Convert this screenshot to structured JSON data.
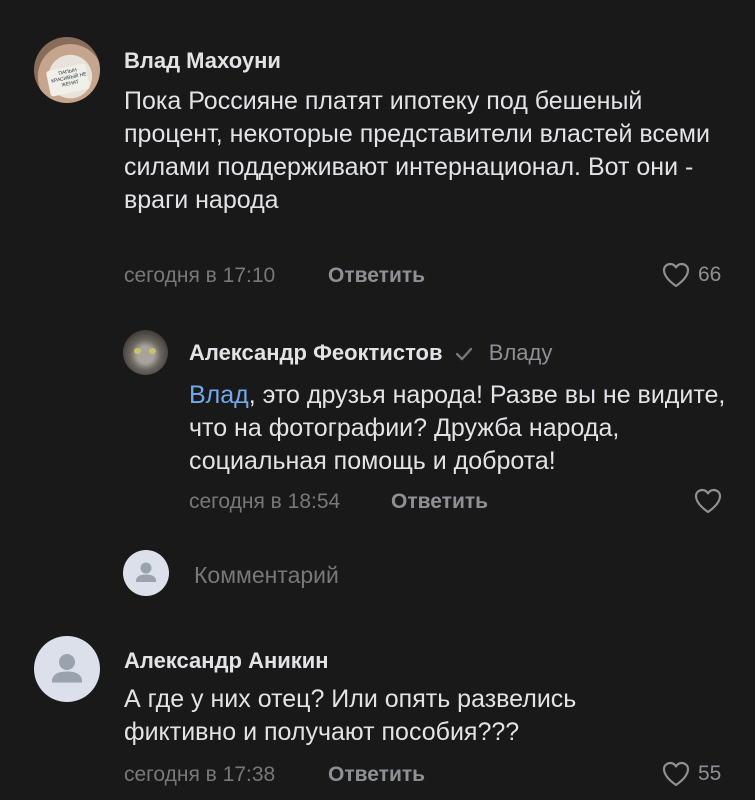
{
  "comments": [
    {
      "author": "Влад Махоуни",
      "text": "Пока Россияне платят ипотеку под бешеный процент, некоторые представители властей всеми силами поддерживают интернационал. Вот они - враги народа",
      "time": "сегодня в 17:10",
      "reply_label": "Ответить",
      "likes": "66",
      "avatar_text": "ПАПЫН КРАСИВЫЙ НЕ ЖЕНАТ"
    },
    {
      "author": "Александр Феоктистов",
      "reply_to": "Владу",
      "mention": "Влад",
      "text": ", это друзья народа! Разве вы не видите, что на фотографии? Дружба народа, социальная помощь и доброта!",
      "time": "сегодня в 18:54",
      "reply_label": "Ответить"
    },
    {
      "author": "Александр Аникин",
      "text": "А где у них отец? Или опять развелись фиктивно и получают пособия???",
      "time": "сегодня в 17:38",
      "reply_label": "Ответить",
      "likes": "55"
    }
  ],
  "composer": {
    "placeholder": "Комментарий"
  },
  "colors": {
    "background": "#19191a",
    "text": "#e1e3e6",
    "secondary": "#76787a",
    "link": "#71aaeb",
    "avatar_placeholder": "#dbe0ea"
  }
}
